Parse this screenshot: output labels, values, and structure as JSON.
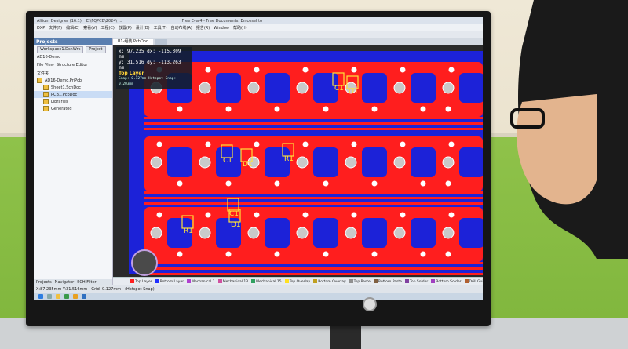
{
  "app": {
    "title": "Altium Designer (16.1)",
    "path_fragment": "E:\\FQPCB\\2024\\ ...",
    "center_text": "Free Eval4 - Free Documents: Emcesel to"
  },
  "menu": [
    "DXP",
    "文件(F)",
    "编辑(E)",
    "察看(V)",
    "工程(C)",
    "放置(P)",
    "设计(D)",
    "工具(T)",
    "自动布线(A)",
    "报告(R)",
    "Window",
    "帮助(H)"
  ],
  "panel": {
    "title": "Projects",
    "workspace": "Workspace1.DsnWrk",
    "project_button": "Project",
    "project_label": "AD16-Demo",
    "view_file": "File View",
    "view_structure": "Structure Editor",
    "section_label": "文件夹",
    "tree": [
      {
        "label": "AD16-Demo.PrjPcb",
        "selected": false,
        "indent": 0
      },
      {
        "label": "Sheet1.SchDoc",
        "selected": false,
        "indent": 1
      },
      {
        "label": "PCB1.PcbDoc",
        "selected": true,
        "indent": 1
      },
      {
        "label": "Libraries",
        "selected": false,
        "indent": 1
      },
      {
        "label": "Generated",
        "selected": false,
        "indent": 1
      }
    ],
    "tabs": [
      "Projects",
      "Navigator",
      "SCH Filter"
    ]
  },
  "doc_tabs": [
    {
      "label": "B1-组装.PcbDoc",
      "active": true
    },
    {
      "label": "...",
      "active": false
    }
  ],
  "coord_overlay": {
    "xy": "x: 97.235   dx: -115.309 mm",
    "y": "y: 31.516   dy: -113.263 mm",
    "layer": "Top Layer",
    "snap": "Snap: 0.127mm  Hotspot Snap: 0.203mm"
  },
  "board_labels": {
    "c1": "C1",
    "d1": "D1",
    "r1": "R1"
  },
  "colors": {
    "copper": "#ff1e1e",
    "board": "#1c22d8",
    "silk": "#ffe23a",
    "pad": "#c9c9c9"
  },
  "layers": [
    {
      "name": "Top Layer",
      "color": "#ff2020"
    },
    {
      "name": "Bottom Layer",
      "color": "#2030ff"
    },
    {
      "name": "Mechanical 1",
      "color": "#b040d0"
    },
    {
      "name": "Mechanical 13",
      "color": "#d050a0"
    },
    {
      "name": "Mechanical 15",
      "color": "#30a060"
    },
    {
      "name": "Top Overlay",
      "color": "#ffe020"
    },
    {
      "name": "Bottom Overlay",
      "color": "#c0a020"
    },
    {
      "name": "Top Paste",
      "color": "#909090"
    },
    {
      "name": "Bottom Paste",
      "color": "#806040"
    },
    {
      "name": "Top Solder",
      "color": "#8040a0"
    },
    {
      "name": "Bottom Solder",
      "color": "#a040c0"
    },
    {
      "name": "Drill Guide",
      "color": "#b06030"
    },
    {
      "name": "Keep-Out Layer",
      "color": "#e030e0"
    },
    {
      "name": "Drill Drawing",
      "color": "#e04080"
    }
  ],
  "status": {
    "xy": "X:87.235mm Y:31.516mm",
    "grid": "Grid: 0.127mm",
    "hotspot": "(Hotspot Snap)"
  },
  "taskbar_icons": [
    "windows-icon",
    "search-icon",
    "explorer-icon",
    "browser-icon",
    "altium-icon",
    "mail-icon"
  ]
}
